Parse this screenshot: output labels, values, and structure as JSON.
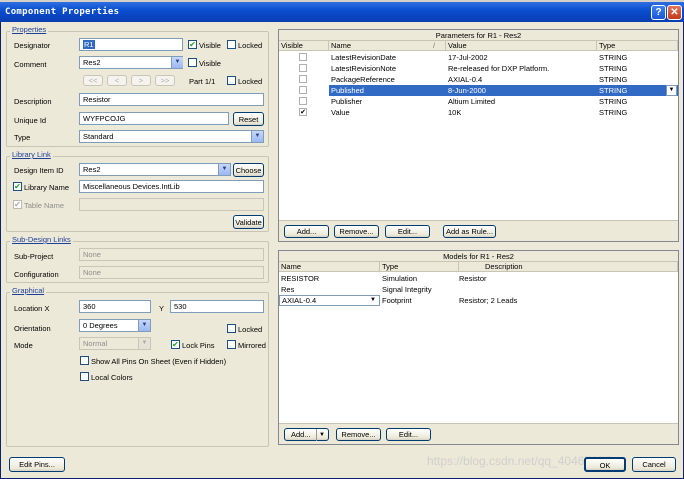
{
  "window": {
    "title": "Component Properties"
  },
  "properties": {
    "section": "Properties",
    "designator": {
      "label": "Designator",
      "value": "R1",
      "visible_label": "Visible",
      "locked_label": "Locked"
    },
    "comment": {
      "label": "Comment",
      "value": "Res2",
      "visible_label": "Visible"
    },
    "nav": {
      "first": "<<",
      "prev": "<",
      "next": ">",
      "last": ">>",
      "part": "Part 1/1",
      "locked_label": "Locked"
    },
    "description": {
      "label": "Description",
      "value": "Resistor"
    },
    "unique_id": {
      "label": "Unique Id",
      "value": "WYFPCOJG",
      "reset": "Reset"
    },
    "type": {
      "label": "Type",
      "value": "Standard"
    }
  },
  "library_link": {
    "section": "Library Link",
    "design_item_id": {
      "label": "Design Item ID",
      "value": "Res2",
      "choose": "Choose"
    },
    "library_name": {
      "label": "Library Name",
      "value": "Miscellaneous Devices.IntLib"
    },
    "table_name": {
      "label": "Table Name",
      "value": ""
    },
    "validate": "Validate"
  },
  "sub_design": {
    "section": "Sub-Design Links",
    "sub_project": {
      "label": "Sub-Project",
      "value": "None"
    },
    "configuration": {
      "label": "Configuration",
      "value": "None"
    }
  },
  "graphical": {
    "section": "Graphical",
    "location": {
      "label": "Location X",
      "x": "360",
      "y_label": "Y",
      "y": "530"
    },
    "orientation": {
      "label": "Orientation",
      "value": "0 Degrees",
      "locked_label": "Locked"
    },
    "mode": {
      "label": "Mode",
      "value": "Normal",
      "lock_pins": "Lock Pins",
      "mirrored": "Mirrored"
    },
    "show_all_pins": "Show All Pins On Sheet (Even if Hidden)",
    "local_colors": "Local Colors"
  },
  "parameters": {
    "title": "Parameters for R1 - Res2",
    "columns": [
      "Visible",
      "Name",
      "/",
      "Value",
      "Type"
    ],
    "rows": [
      {
        "name": "LatestRevisionDate",
        "value": "17-Jul-2002",
        "type": "STRING"
      },
      {
        "name": "LatestRevisionNote",
        "value": "Re-released for DXP Platform.",
        "type": "STRING"
      },
      {
        "name": "PackageReference",
        "value": "AXIAL-0.4",
        "type": "STRING"
      },
      {
        "name": "Published",
        "value": "8-Jun-2000",
        "type": "STRING"
      },
      {
        "name": "Publisher",
        "value": "Altium Limited",
        "type": "STRING"
      },
      {
        "name": "Value",
        "value": "10K",
        "type": "STRING",
        "check": "✔"
      }
    ],
    "buttons": {
      "add": "Add...",
      "remove": "Remove...",
      "edit": "Edit...",
      "add_rule": "Add as Rule..."
    }
  },
  "models": {
    "title": "Models for R1 - Res2",
    "columns": [
      "Name",
      "Type",
      "▽",
      "Description"
    ],
    "rows": [
      {
        "name": "RESISTOR",
        "type": "Simulation",
        "description": "Resistor"
      },
      {
        "name": "Res",
        "type": "Signal Integrity",
        "description": ""
      },
      {
        "name": "AXIAL-0.4",
        "type": "Footprint",
        "description": "Resistor; 2 Leads"
      }
    ],
    "buttons": {
      "add": "Add...",
      "remove": "Remove...",
      "edit": "Edit..."
    }
  },
  "footer": {
    "edit_pins": "Edit Pins...",
    "ok": "OK",
    "cancel": "Cancel"
  },
  "watermark": "https://blog.csdn.net/qq_40467375"
}
